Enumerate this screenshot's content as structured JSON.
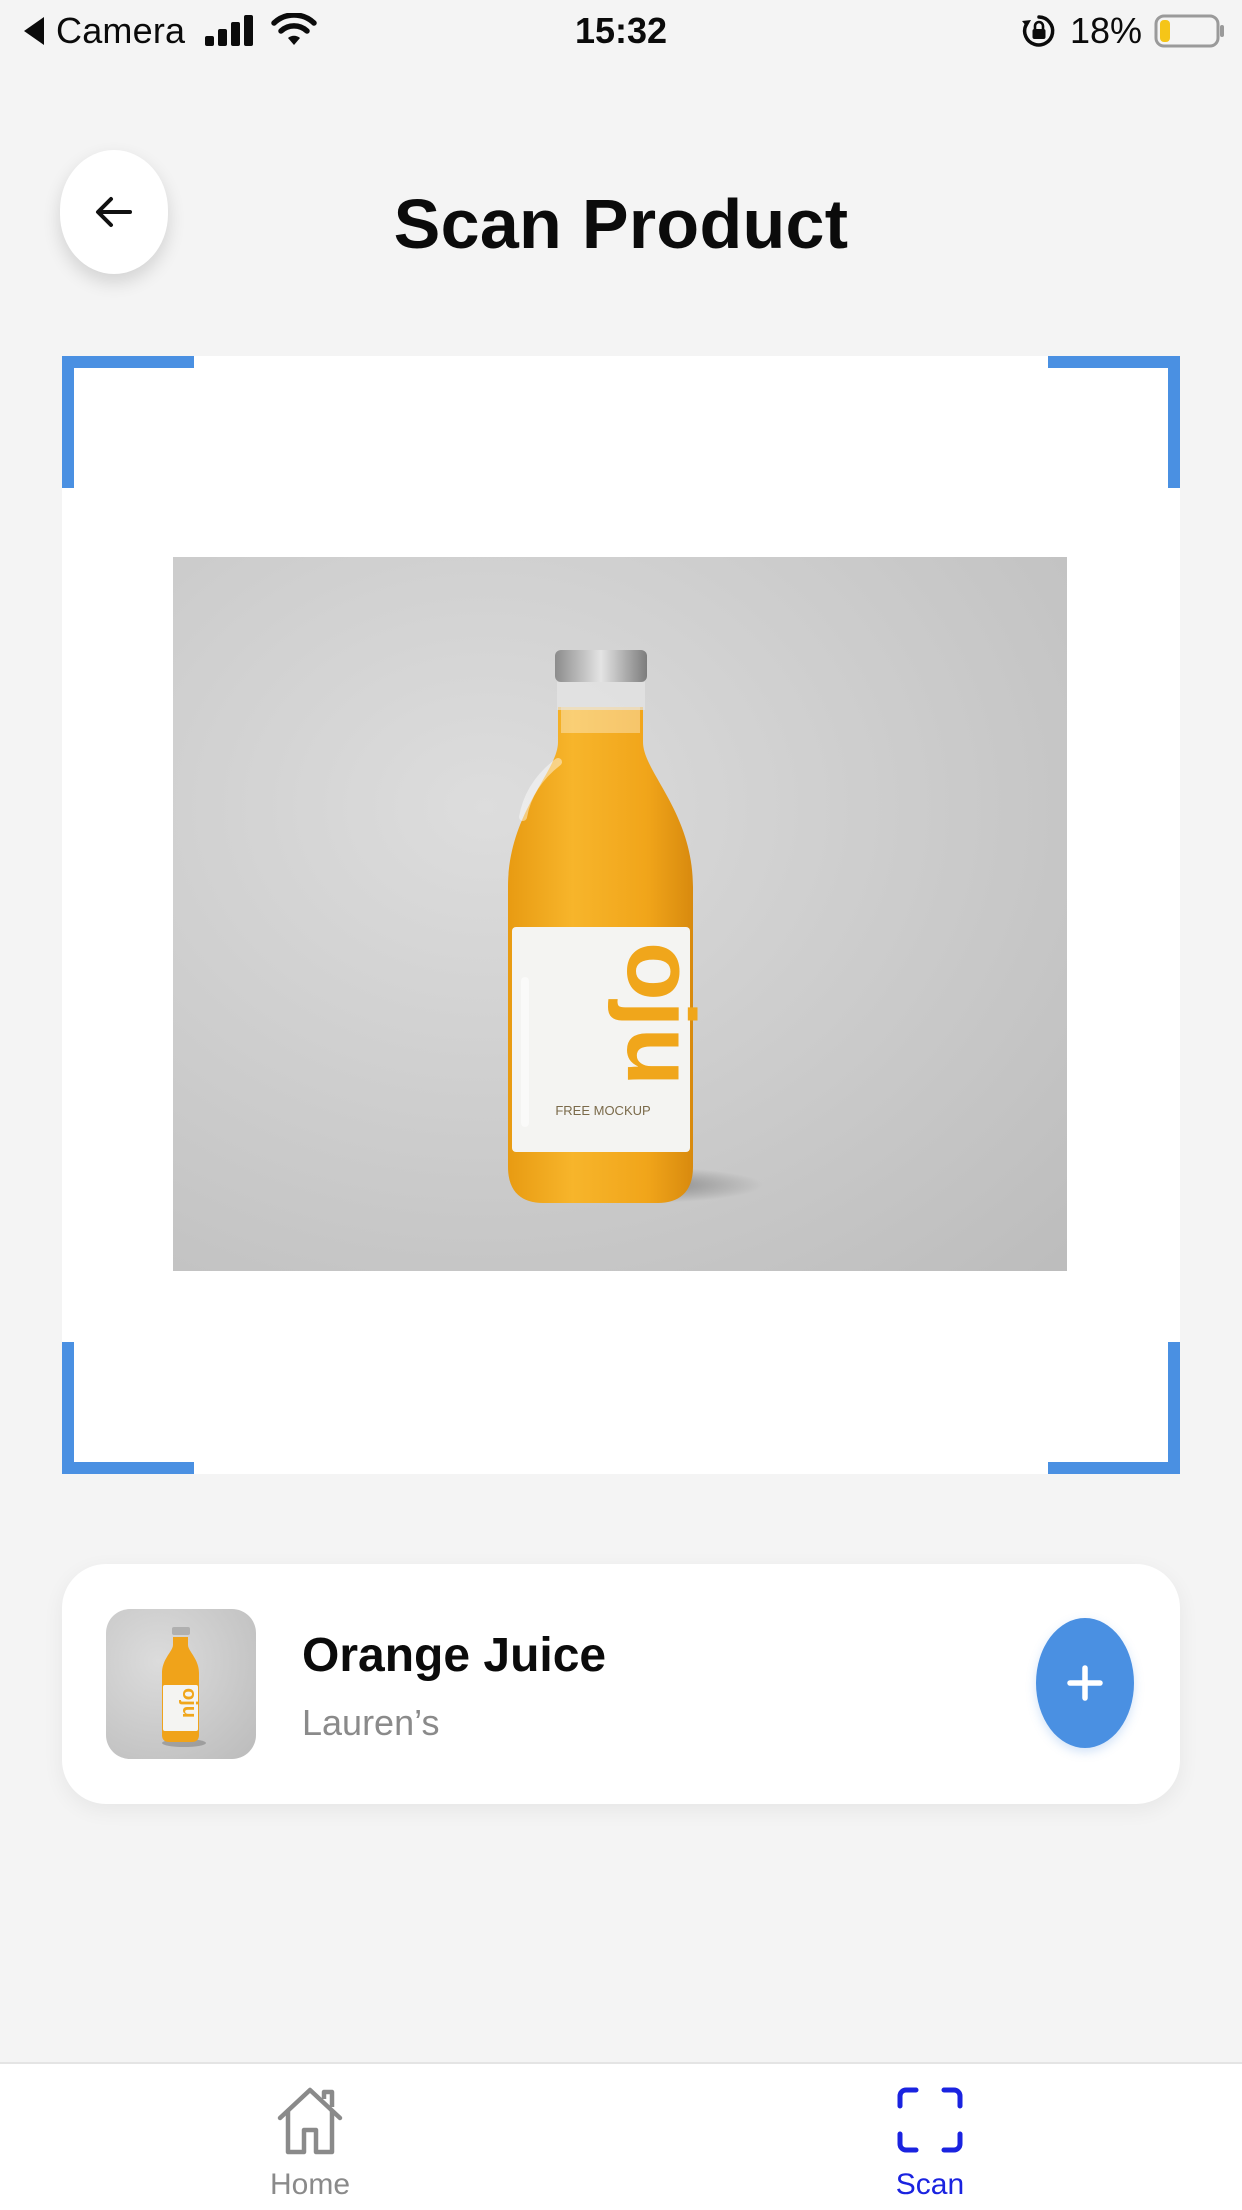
{
  "status_bar": {
    "back_app": "Camera",
    "time": "15:32",
    "battery": "18%",
    "battery_level": 0.18,
    "icons": [
      "back-caret-icon",
      "cellular-signal-icon",
      "wifi-icon",
      "orientation-lock-icon",
      "battery-icon"
    ]
  },
  "header": {
    "title": "Scan Product",
    "back_icon": "arrow-left-icon"
  },
  "scanner": {
    "frame_color": "#4a90e2",
    "label_text": "oju",
    "label_subtext": "FREE MOCKUP"
  },
  "result": {
    "name": "Orange Juice",
    "brand": "Lauren’s",
    "add_icon": "plus-icon",
    "add_color": "#4a90e2"
  },
  "tab_bar": {
    "tabs": [
      {
        "label": "Home",
        "icon": "home-icon",
        "active": false
      },
      {
        "label": "Scan",
        "icon": "scan-icon",
        "active": true
      }
    ],
    "active_color": "#1a23e0",
    "inactive_color": "#8a8a8a"
  }
}
